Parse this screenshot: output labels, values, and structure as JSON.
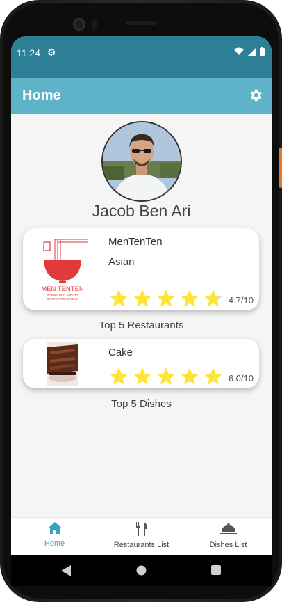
{
  "status_bar": {
    "time": "11:24",
    "settings_icon": "gear-icon",
    "icons": [
      "wifi-icon",
      "signal-icon",
      "battery-icon"
    ]
  },
  "app_bar": {
    "title": "Home",
    "settings_icon": "gear-icon"
  },
  "profile": {
    "name": "Jacob Ben Ari"
  },
  "top_restaurant": {
    "logo_text": "MEN TENTEN",
    "logo_subtext": "RAMEN BAR ZAKAYA",
    "logo_tagline": "BY MAKOTO OKIZAKI",
    "name": "MenTenTen",
    "cuisine": "Asian",
    "stars": 4.7,
    "rating": "4.7/10"
  },
  "top_restaurants_label": "Top 5 Restaurants",
  "top_dish": {
    "name": "Cake",
    "stars": 5,
    "rating": "6.0/10"
  },
  "top_dishes_label": "Top 5 Dishes",
  "bottom_nav": {
    "items": [
      {
        "label": "Home",
        "icon": "home-icon",
        "active": true
      },
      {
        "label": "Restaurants List",
        "icon": "fork-knife-icon",
        "active": false
      },
      {
        "label": "Dishes List",
        "icon": "cloche-icon",
        "active": false
      }
    ]
  },
  "colors": {
    "status_bar": "#2d7f95",
    "app_bar": "#5fb3c9",
    "accent": "#3a9fc0",
    "star_filled": "#fce43b",
    "star_empty": "#d8d8d8",
    "logo_red": "#e23a3a"
  }
}
